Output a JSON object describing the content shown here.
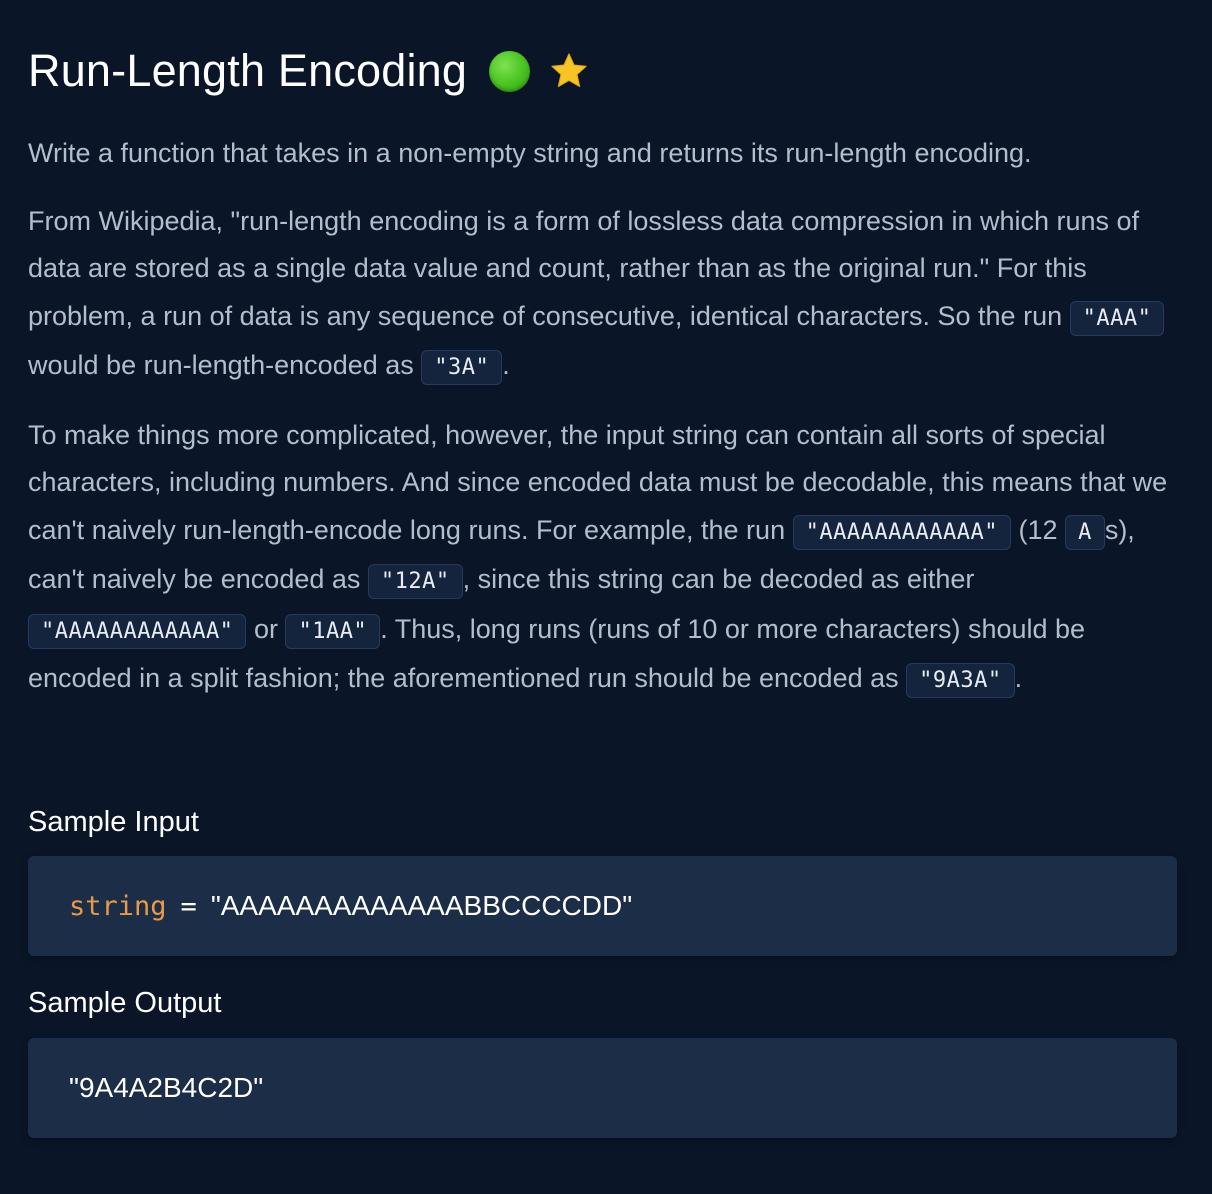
{
  "title": "Run-Length Encoding",
  "icons": {
    "difficulty": "green-circle-icon",
    "favorite": "star-icon",
    "difficulty_color": "#46c21f",
    "star_color": "#f5c518"
  },
  "description": {
    "p1": "Write a function that takes in a non-empty string and returns its run-length encoding.",
    "p2": {
      "t1": "From Wikipedia, \"run-length encoding is a form of lossless data compression in which runs of data are stored as a single data value and count, rather than as the original run.\" For this problem, a run of data is any sequence of consecutive, identical characters. So the run ",
      "c1": "\"AAA\"",
      "t2": " would be run-length-encoded as ",
      "c2": "\"3A\"",
      "t3": "."
    },
    "p3": {
      "t1": "To make things more complicated, however, the input string can contain all sorts of special characters, including numbers. And since encoded data must be decodable, this means that we can't naively run-length-encode long runs. For example, the run ",
      "c1": "\"AAAAAAAAAAAA\"",
      "t2": " (12 ",
      "c2": "A",
      "t3": "s), can't naively be encoded as ",
      "c3": "\"12A\"",
      "t4": ", since this string can be decoded as either ",
      "c4": "\"AAAAAAAAAAAA\"",
      "t5": " or ",
      "c5": "\"1AA\"",
      "t6": ". Thus, long runs (runs of 10 or more characters) should be encoded in a split fashion; the aforementioned run should be encoded as ",
      "c6": "\"9A3A\"",
      "t7": "."
    }
  },
  "sample_input": {
    "label": "Sample Input",
    "var_name": "string",
    "operator": "=",
    "value": "\"AAAAAAAAAAAAABBCCCCDD\""
  },
  "sample_output": {
    "label": "Sample Output",
    "value": "\"9A4A2B4C2D\""
  }
}
